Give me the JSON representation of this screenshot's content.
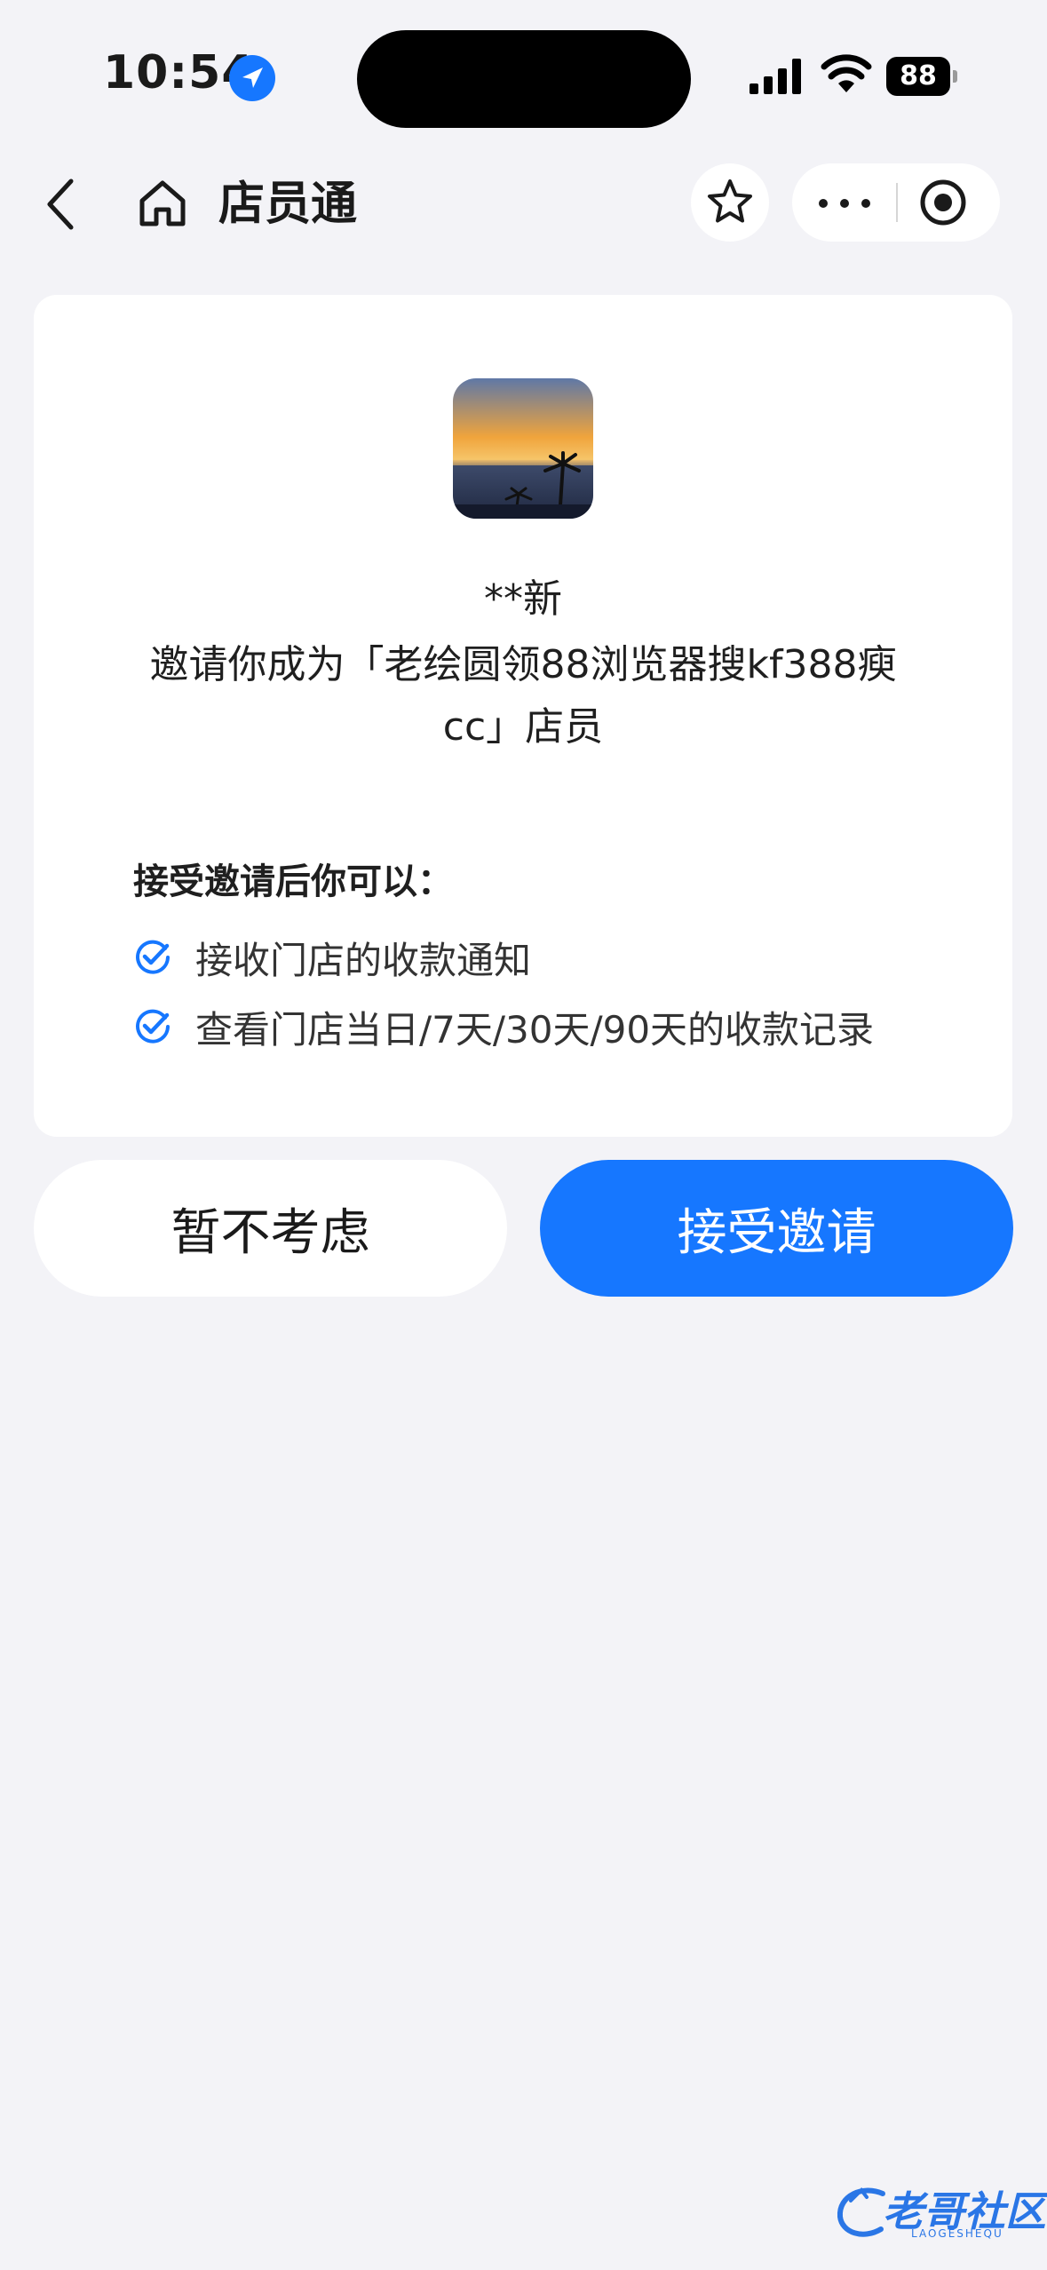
{
  "status_bar": {
    "time": "10:54",
    "battery": "88"
  },
  "nav": {
    "title": "店员通"
  },
  "invite": {
    "inviter": "**新",
    "message": "邀请你成为「老绘圆领88浏览器搜kf388瘐cc」店员",
    "permissions_title": "接受邀请后你可以：",
    "permissions": [
      "接收门店的收款通知",
      "查看门店当日/7天/30天/90天的收款记录"
    ]
  },
  "actions": {
    "decline_label": "暂不考虑",
    "accept_label": "接受邀请"
  },
  "watermark": {
    "text": "老哥社区",
    "sub": "LAOGESHEQU"
  },
  "colors": {
    "accent": "#1677ff",
    "background": "#f3f3f7",
    "card": "#ffffff"
  }
}
